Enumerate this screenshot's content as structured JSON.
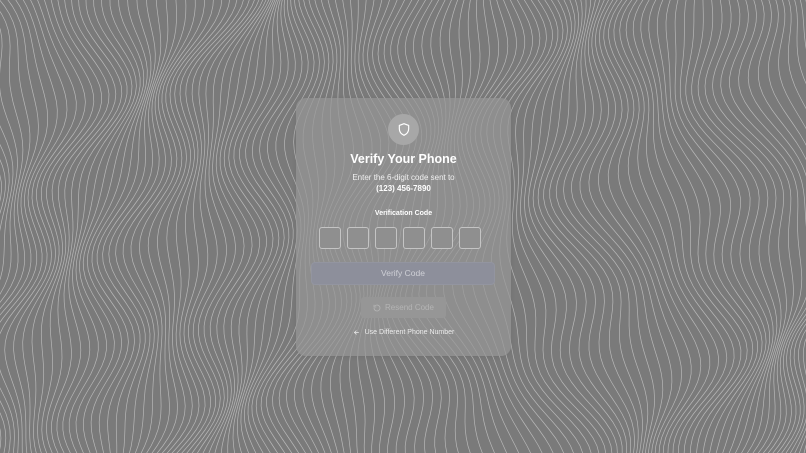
{
  "page": {
    "background_color": "#7a7a7a"
  },
  "card": {
    "icon": "shield-icon",
    "title": "Verify Your Phone",
    "subtitle": "Enter the 6-digit code sent to",
    "phone": "(123) 456-7890",
    "code_label": "Verification Code",
    "code_digits": [
      "",
      "",
      "",
      "",
      "",
      ""
    ],
    "verify_label": "Verify Code",
    "resend_label": "Resend Code",
    "resend_icon": "refresh-icon",
    "different_label": "Use Different Phone Number",
    "different_icon": "arrow-left-icon"
  },
  "colors": {
    "accent_button": "#8d8f9b",
    "card_overlay": "#969696"
  }
}
